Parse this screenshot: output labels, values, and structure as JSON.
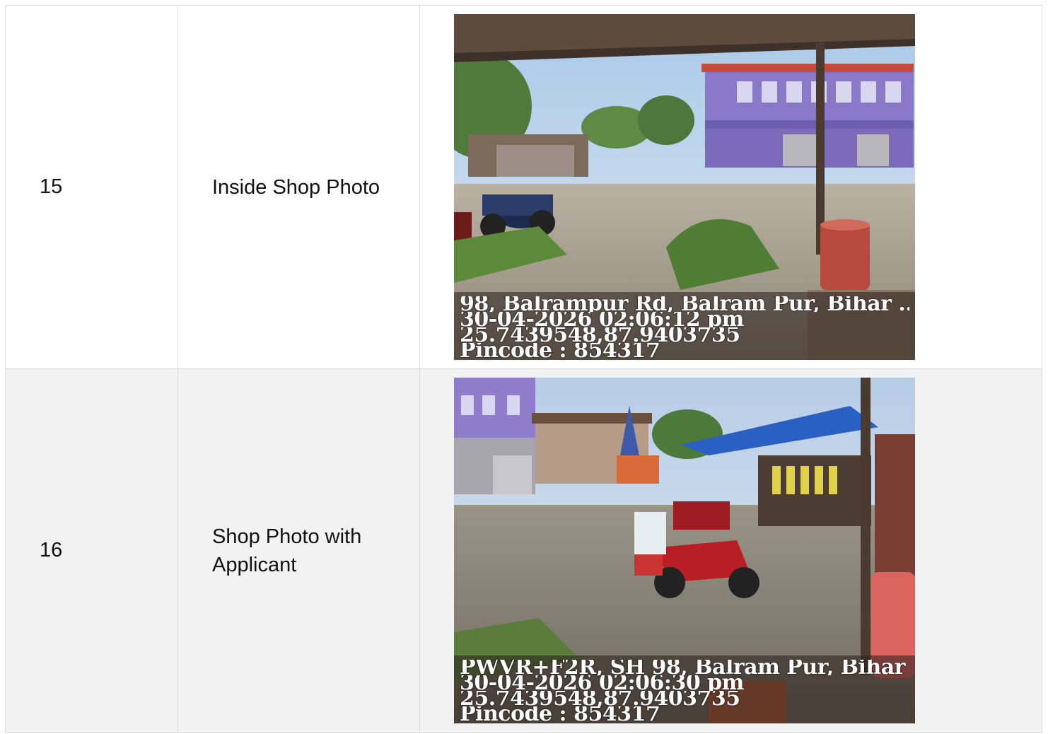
{
  "rows": [
    {
      "num": "15",
      "label": "Inside Shop Photo",
      "stamp": {
        "address": "98, Balrampur Rd, Balram Pur, Bihar ...",
        "datetime": "30-04-2026 02:06:12 pm",
        "coords": "25.7439548,87.9403735",
        "pincode": "Pincode : 854317"
      }
    },
    {
      "num": "16",
      "label": "Shop Photo with Applicant",
      "stamp": {
        "address": "PWVR+F2R, SH 98, Balram Pur, Bihar ...",
        "datetime": "30-04-2026 02:06:30 pm",
        "coords": "25.7439548,87.9403735",
        "pincode": "Pincode : 854317"
      }
    }
  ]
}
